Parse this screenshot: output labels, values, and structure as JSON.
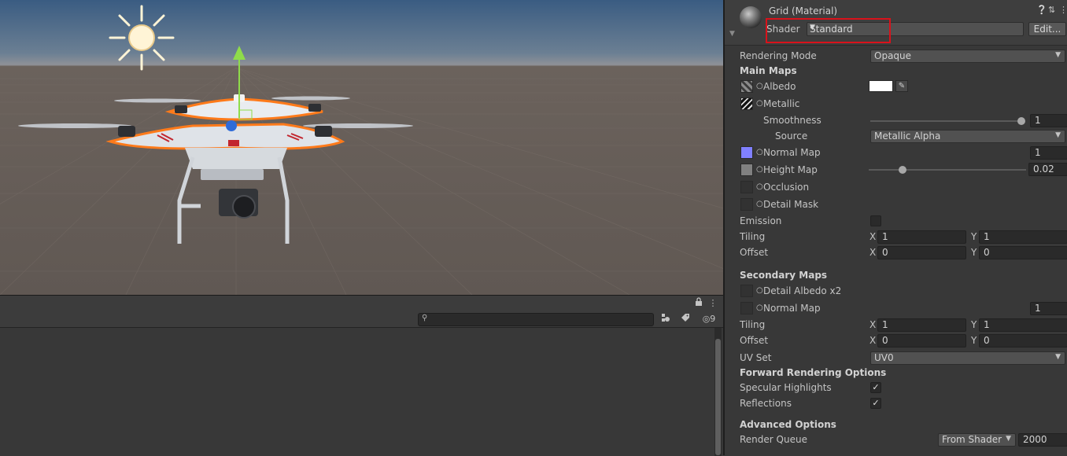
{
  "scene": {
    "name": "Scene view",
    "icons": [
      "sun-icon",
      "drone-model",
      "move-gizmo-up-arrow"
    ]
  },
  "bottom_panel": {
    "search_placeholder": "",
    "badge_count": "9",
    "icons": [
      "lock-icon",
      "more-menu-icon",
      "search-icon",
      "scene-filter-icon",
      "tag-icon",
      "hidden-eye-icon"
    ]
  },
  "inspector": {
    "title": "Grid (Material)",
    "shader_label": "Shader",
    "shader_value": "Standard",
    "edit_label": "Edit...",
    "rendering_mode_label": "Rendering Mode",
    "rendering_mode_value": "Opaque",
    "main_maps": {
      "header": "Main Maps",
      "albedo": "Albedo",
      "metallic": "Metallic",
      "smoothness": "Smoothness",
      "smoothness_value": "1",
      "smoothness_level": 1.0,
      "source": "Source",
      "source_value": "Metallic Alpha",
      "normal_map": "Normal Map",
      "normal_map_value": "1",
      "height_map": "Height Map",
      "height_map_value": "0.02",
      "height_map_level": 0.2,
      "occlusion": "Occlusion",
      "detail_mask": "Detail Mask",
      "emission": "Emission",
      "tiling": "Tiling",
      "tiling_x": "1",
      "tiling_y": "1",
      "offset": "Offset",
      "offset_x": "0",
      "offset_y": "0"
    },
    "secondary_maps": {
      "header": "Secondary Maps",
      "detail_albedo": "Detail Albedo x2",
      "normal_map": "Normal Map",
      "normal_map_value": "1",
      "tiling": "Tiling",
      "tiling_x": "1",
      "tiling_y": "1",
      "offset": "Offset",
      "offset_x": "0",
      "offset_y": "0",
      "uv_set": "UV Set",
      "uv_set_value": "UV0"
    },
    "forward_rendering": {
      "header": "Forward Rendering Options",
      "specular_highlights": "Specular Highlights",
      "reflections": "Reflections"
    },
    "advanced": {
      "header": "Advanced Options",
      "render_queue": "Render Queue",
      "render_queue_source": "From Shader",
      "render_queue_value": "2000"
    },
    "axis_x": "X",
    "axis_y": "Y",
    "colors": {
      "highlight": "#d9121b",
      "normal_map_swatch": "#8080ff",
      "albedo_swatch": "#ffffff"
    }
  }
}
